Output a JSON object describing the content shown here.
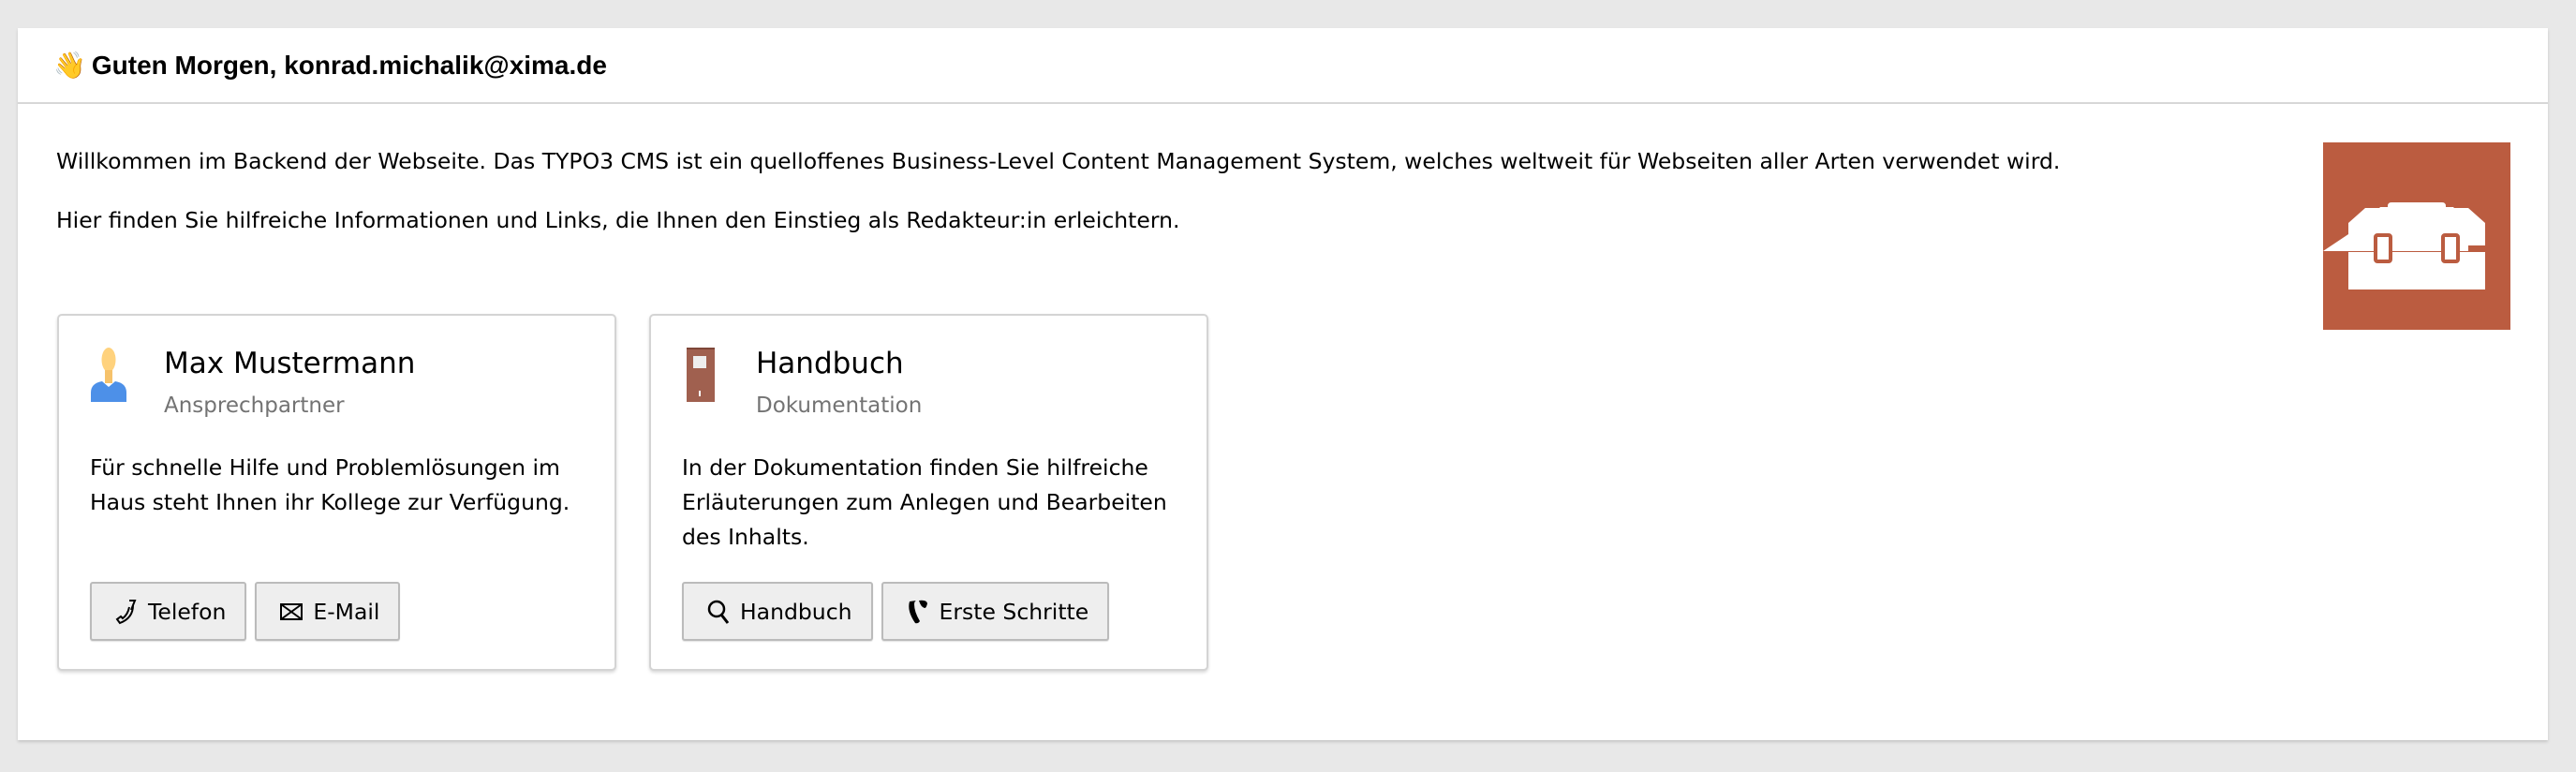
{
  "header": {
    "greeting_emoji": "👋",
    "title": "Guten Morgen, konrad.michalik@xima.de"
  },
  "intro": {
    "line1": "Willkommen im Backend der Webseite. Das TYPO3 CMS ist ein quelloffenes Business-Level Content Management System, welches weltweit für Webseiten aller Arten verwendet wird.",
    "line2": "Hier finden Sie hilfreiche Informationen und Links, die Ihnen den Einstieg als Redakteur:in erleichtern."
  },
  "toolbox": {
    "icon": "toolbox-icon",
    "color": "#bb5c40"
  },
  "cards": [
    {
      "icon": "user-icon",
      "title": "Max Mustermann",
      "subtitle": "Ansprechpartner",
      "description": "Für schnelle Hilfe und Problemlösungen im Haus steht Ihnen ihr Kollege zur Verfügung.",
      "buttons": [
        {
          "icon": "phone-icon",
          "label": "Telefon"
        },
        {
          "icon": "envelope-icon",
          "label": "E-Mail"
        }
      ]
    },
    {
      "icon": "book-icon",
      "title": "Handbuch",
      "subtitle": "Dokumentation",
      "description": "In der Dokumentation finden Sie hilfreiche Erläuterungen zum Anlegen und Bearbeiten des Inhalts.",
      "buttons": [
        {
          "icon": "search-icon",
          "label": "Handbuch"
        },
        {
          "icon": "typo3-icon",
          "label": "Erste Schritte"
        }
      ]
    }
  ]
}
